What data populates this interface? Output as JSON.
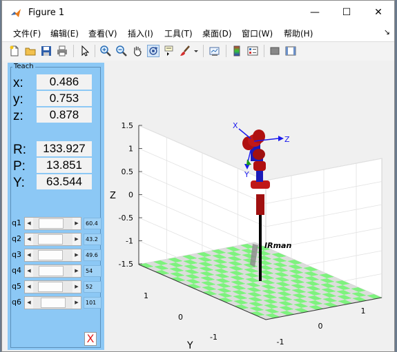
{
  "window": {
    "title": "Figure 1",
    "minimize": "—",
    "maximize": "☐",
    "close": "✕"
  },
  "menu": {
    "items": [
      "文件(F)",
      "编辑(E)",
      "查看(V)",
      "插入(I)",
      "工具(T)",
      "桌面(D)",
      "窗口(W)",
      "帮助(H)"
    ],
    "overflow": "↘"
  },
  "toolbar": {
    "icons": [
      "new-figure-icon",
      "open-file-icon",
      "save-icon",
      "print-icon",
      "pointer-icon",
      "zoom-in-icon",
      "zoom-out-icon",
      "pan-icon",
      "rotate-3d-icon",
      "data-cursor-icon",
      "brush-icon",
      "dropdown-arrow-icon",
      "link-plot-icon",
      "colorbar-icon",
      "legend-icon",
      "hide-plot-tools-icon",
      "show-plot-tools-icon"
    ],
    "active": "rotate-3d-icon"
  },
  "teach": {
    "title": "Teach",
    "position": [
      {
        "label": "x:",
        "value": "0.486"
      },
      {
        "label": "y:",
        "value": "0.753"
      },
      {
        "label": "z:",
        "value": "0.878"
      }
    ],
    "orientation": [
      {
        "label": "R:",
        "value": "133.927"
      },
      {
        "label": "P:",
        "value": "13.851"
      },
      {
        "label": "Y:",
        "value": "63.544"
      }
    ],
    "joints": [
      {
        "label": "q1",
        "value": "60.4",
        "fraction": 0.34
      },
      {
        "label": "q2",
        "value": "43.2",
        "fraction": 0.32
      },
      {
        "label": "q3",
        "value": "49.6",
        "fraction": 0.32
      },
      {
        "label": "q4",
        "value": "54",
        "fraction": 0.34
      },
      {
        "label": "q5",
        "value": "52",
        "fraction": 0.3
      },
      {
        "label": "q6",
        "value": "101",
        "fraction": 0.49
      }
    ],
    "close_label": "X"
  },
  "plot": {
    "z_label": "Z",
    "y_label": "Y",
    "z_ticks": [
      "1.5",
      "1",
      "0.5",
      "0",
      "-0.5",
      "-1",
      "-1.5"
    ],
    "y_ticks": [
      "1",
      "0",
      "-1"
    ],
    "x_ticks": [
      "1",
      "0",
      "-1"
    ],
    "robot_name": "IRman",
    "frame_labels": {
      "x": "X",
      "y": "Y",
      "z": "Z"
    },
    "colors": {
      "floor_a": "#7ef27e",
      "floor_b": "#dcdcdc",
      "link": "#1a1ab8",
      "joint": "#b01010",
      "panel": "#8cc8f5"
    }
  }
}
